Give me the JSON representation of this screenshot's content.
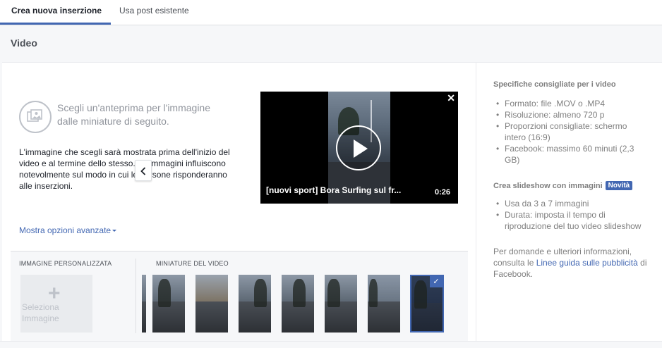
{
  "tabs": [
    {
      "label": "Crea nuova inserzione",
      "active": true
    },
    {
      "label": "Usa post esistente",
      "active": false
    }
  ],
  "section": {
    "title": "Video"
  },
  "preview": {
    "title": "Scegli un'anteprima per l'immagine dalle miniature di seguito.",
    "description": "L'immagine che scegli sarà mostrata prima dell'inizio del video e al termine dello stesso. Le immagini influiscono notevolmente sul modo in cui le persone risponderanno alle inserzioni.",
    "icon": "image-preview-icon"
  },
  "video": {
    "title": "[nuovi sport] Bora Surfing sul fr...",
    "duration": "0:26",
    "close_glyph": "✕"
  },
  "more_options": {
    "label": "Mostra opzioni avanzate"
  },
  "thumbnails": {
    "custom_label": "IMMAGINE PERSONALIZZATA",
    "video_label": "MINIATURE DEL VIDEO",
    "select_label": "Seleziona Immagine",
    "plus_glyph": "+",
    "check_glyph": "✓",
    "count": 8,
    "selected_index": 7
  },
  "specs": {
    "heading": "Specifiche consigliate per i video",
    "items": [
      "Formato: file .MOV o .MP4",
      "Risoluzione: almeno 720 p",
      "Proporzioni consigliate: schermo intero (16:9)",
      "Facebook: massimo 60 minuti (2,3 GB)"
    ]
  },
  "slideshow": {
    "heading": "Crea slideshow con immagini",
    "badge": "Novità",
    "items": [
      "Usa da 3 a 7 immagini",
      "Durata: imposta il tempo di riproduzione del tuo video slideshow"
    ]
  },
  "info": {
    "prefix": "Per domande e ulteriori informazioni, consulta le ",
    "link": "Linee guida sulle pubblicità",
    "suffix": " di Facebook."
  },
  "colors": {
    "accent": "#4267b2",
    "muted_text": "#7f7f7f",
    "panel_bg": "#f6f7f9"
  }
}
